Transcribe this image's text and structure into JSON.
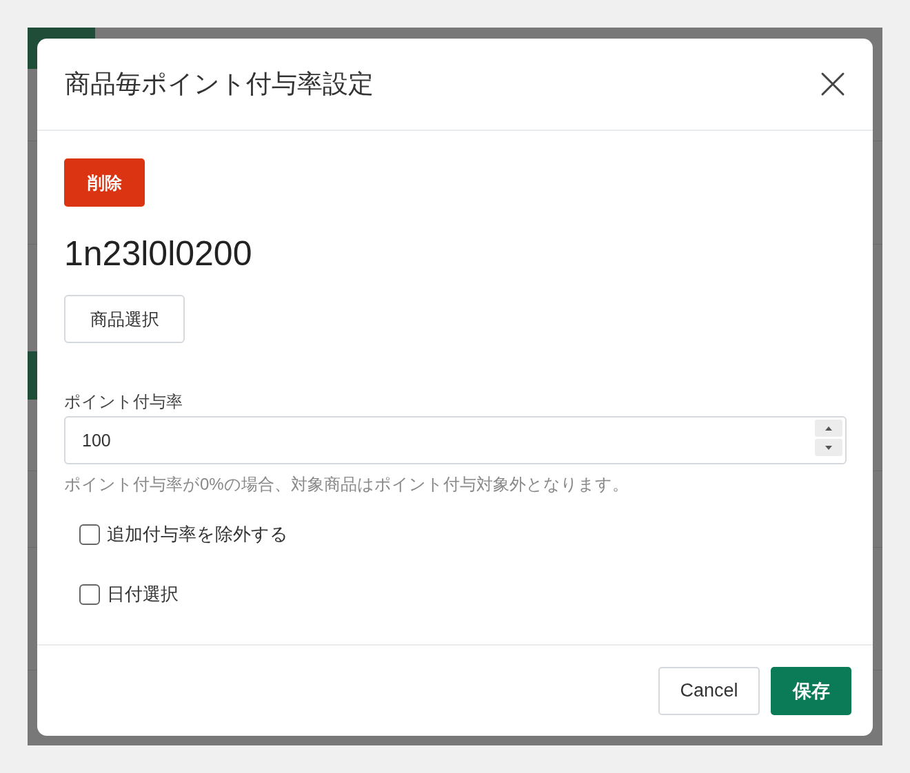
{
  "dialog": {
    "title": "商品毎ポイント付与率設定",
    "delete_button": "削除",
    "product_code": "1n23l0l0200",
    "select_button": "商品選択",
    "rate_field": {
      "label": "ポイント付与率",
      "value": "100"
    },
    "help_text": "ポイント付与率が0%の場合、対象商品はポイント付与対象外となります。",
    "checkboxes": [
      {
        "label": "追加付与率を除外する",
        "checked": false
      },
      {
        "label": "日付選択",
        "checked": false
      }
    ],
    "buttons": [
      {
        "label": "Cancel",
        "kind": "secondary"
      },
      {
        "label": "保存",
        "kind": "primary"
      }
    ]
  }
}
